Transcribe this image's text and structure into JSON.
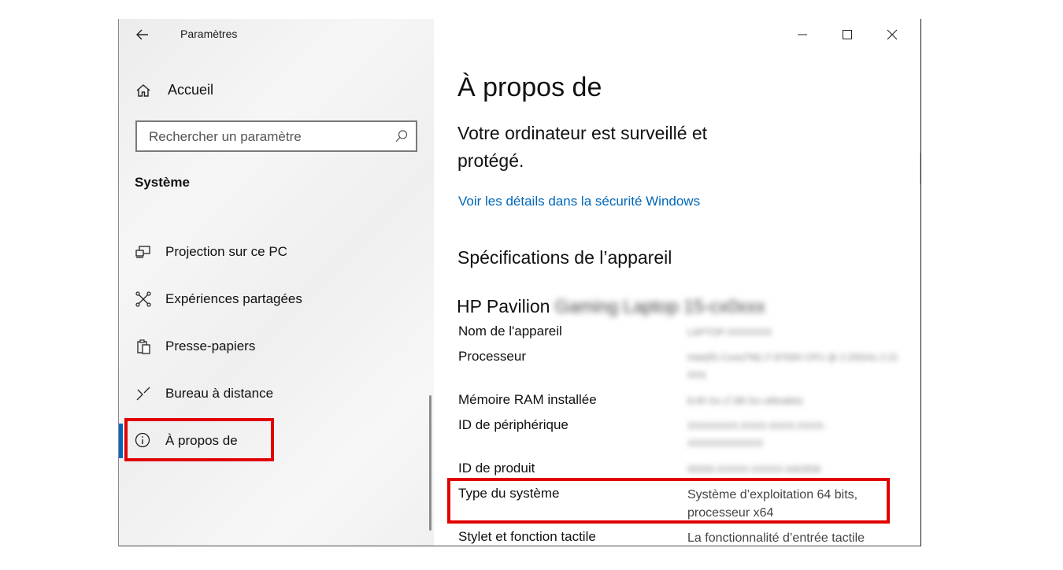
{
  "window": {
    "app_title": "Paramètres",
    "controls": {
      "minimize": "minimize-icon",
      "maximize": "maximize-icon",
      "close": "close-icon"
    }
  },
  "sidebar": {
    "home_label": "Accueil",
    "search": {
      "placeholder": "Rechercher un paramètre"
    },
    "section_title": "Système",
    "items": [
      {
        "label": "Projection sur ce PC",
        "icon": "projection-icon"
      },
      {
        "label": "Expériences partagées",
        "icon": "shared-experiences-icon"
      },
      {
        "label": "Presse-papiers",
        "icon": "clipboard-icon"
      },
      {
        "label": "Bureau à distance",
        "icon": "remote-desktop-icon"
      },
      {
        "label": "À propos de",
        "icon": "info-icon",
        "selected": true
      }
    ]
  },
  "content": {
    "page_title": "À propos de",
    "protection_text": "Votre ordinateur est surveillé et protégé.",
    "security_link": "Voir les détails dans la sécurité Windows",
    "specs_title": "Spécifications de l’appareil",
    "device_model": "HP Pavilion",
    "device_model_blurred": "Gaming Laptop 15-cx0xxx",
    "specs": [
      {
        "key": "Nom de l'appareil",
        "value": "LAPTOP-XXXXXXX",
        "blurred": true
      },
      {
        "key": "Processeur",
        "value": "Intel(R) Core(TM) i7-8750H CPU @ 2.20GHz 2.21 GHz",
        "blurred": true
      },
      {
        "key": "Mémoire RAM installée",
        "value": "8,00 Go (7,88 Go utilisable)",
        "blurred": true
      },
      {
        "key": "ID de périphérique",
        "value": "XXXXXXXX-XXXX-XXXX-XXXX-XXXXXXXXXXXX",
        "blurred": true
      },
      {
        "key": "ID de produit",
        "value": "00325-XXXXX-XXXXX-AAOEM",
        "blurred": true
      },
      {
        "key": "Type du système",
        "value": "Système d’exploitation 64 bits, processeur x64",
        "blurred": false,
        "highlighted": true
      },
      {
        "key": "Stylet et fonction tactile",
        "value": "La fonctionnalité d’entrée tactile",
        "blurred": false
      }
    ]
  },
  "colors": {
    "accent": "#0067c0",
    "link": "#0067b8",
    "highlight_box": "#e00000"
  }
}
